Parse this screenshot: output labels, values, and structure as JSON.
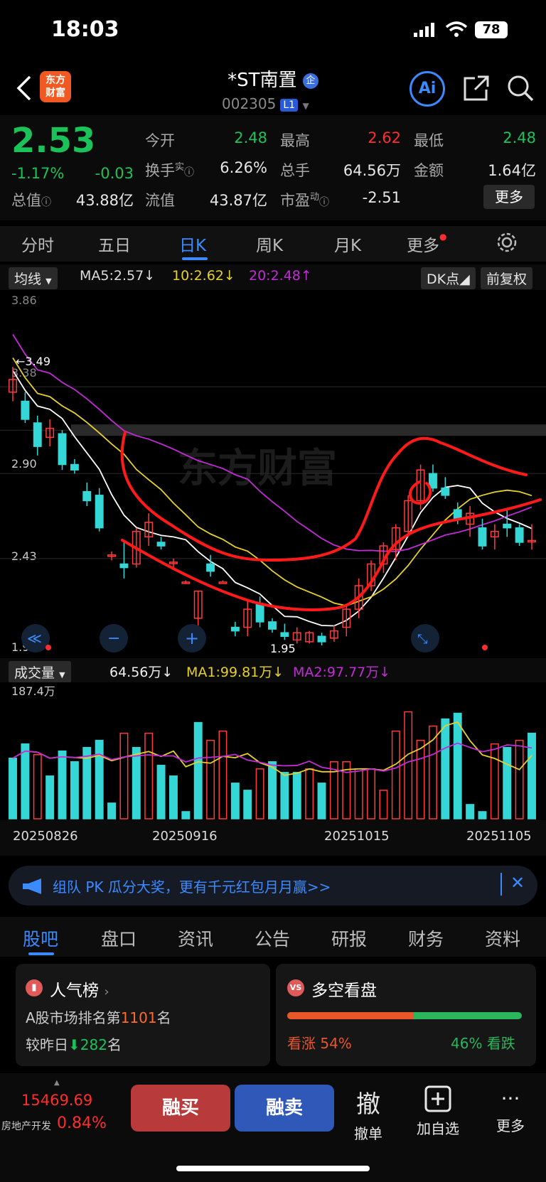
{
  "status": {
    "time": "18:03",
    "battery": "78"
  },
  "header": {
    "name": "*ST南置",
    "badge": "企",
    "code": "002305",
    "level": "L1",
    "logo_line1": "东方",
    "logo_line2": "财富"
  },
  "quote": {
    "price": "2.53",
    "change_pct": "-1.17%",
    "change": "-0.03",
    "open_label": "今开",
    "open": "2.48",
    "high_label": "最高",
    "high": "2.62",
    "low_label": "最低",
    "low": "2.48",
    "turnover_label": "换手",
    "turnover_sup": "实",
    "turnover": "6.26%",
    "volume_label": "总手",
    "volume": "64.56万",
    "amount_label": "金额",
    "amount": "1.64亿",
    "mktcap_label": "总值",
    "mktcap": "43.88亿",
    "float_label": "流值",
    "float": "43.87亿",
    "pe_label": "市盈",
    "pe_sup": "动",
    "pe": "-2.51",
    "more": "更多"
  },
  "tabs": [
    "分时",
    "五日",
    "日K",
    "周K",
    "月K",
    "更多"
  ],
  "ma": {
    "selector": "均线",
    "ma5": "MA5:2.57",
    "ma10": "10:2.62",
    "ma20": "20:2.48",
    "dk": "DK点",
    "adjust": "前复权"
  },
  "chart_axis": {
    "y_top": "3.86",
    "y_2": "3.38",
    "y_3": "2.90",
    "y_4": "2.43",
    "y_low": "1.95",
    "high_mark": "3.49",
    "low_mark": "1.95",
    "watermark": "东方财富"
  },
  "volume": {
    "selector": "成交量",
    "current": "64.56万",
    "ma1": "MA1:99.81万",
    "ma2": "MA2:97.77万",
    "y_max": "187.4万",
    "dates": [
      "20250826",
      "20250916",
      "20251015",
      "20251105"
    ]
  },
  "banner": {
    "text": "组队 PK 瓜分大奖，更有千元红包月月赢>>"
  },
  "bottom_tabs": [
    "股吧",
    "盘口",
    "资讯",
    "公告",
    "研报",
    "财务",
    "资料"
  ],
  "card1": {
    "title": "人气榜",
    "line1_prefix": "A股市场排名第",
    "rank": "1101",
    "line1_suffix": "名",
    "line2_prefix": "较昨日",
    "delta": "282",
    "line2_suffix": "名"
  },
  "card2": {
    "title": "多空看盘",
    "bull_label": "看涨",
    "bull_pct": "54%",
    "bear_pct": "46%",
    "bear_label": "看跌",
    "bull_value": 54
  },
  "footer": {
    "index": "15469.69",
    "sector": "房地产开发",
    "sector_pct": "0.84%",
    "buy": "融买",
    "sell": "融卖",
    "cancel": "撤单",
    "cancel_char": "撤",
    "watch": "加自选",
    "more": "更多"
  },
  "chart_data": {
    "type": "candlestick",
    "y_ticks": [
      3.86,
      3.38,
      2.9,
      2.43,
      1.95
    ],
    "ylim": [
      1.95,
      3.86
    ],
    "vol_ylim": [
      0,
      187.4
    ],
    "candles": [
      [
        3.35,
        3.49,
        3.3,
        3.42
      ],
      [
        3.3,
        3.35,
        3.18,
        3.2
      ],
      [
        3.18,
        3.22,
        3.0,
        3.05
      ],
      [
        3.1,
        3.2,
        3.05,
        3.15
      ],
      [
        3.12,
        3.14,
        2.92,
        2.95
      ],
      [
        2.95,
        2.98,
        2.9,
        2.92
      ],
      [
        2.8,
        2.85,
        2.72,
        2.75
      ],
      [
        2.78,
        2.82,
        2.58,
        2.6
      ],
      [
        2.45,
        2.47,
        2.42,
        2.45
      ],
      [
        2.4,
        2.52,
        2.32,
        2.38
      ],
      [
        2.4,
        2.6,
        2.38,
        2.58
      ],
      [
        2.55,
        2.68,
        2.5,
        2.63
      ],
      [
        2.52,
        2.55,
        2.48,
        2.5
      ],
      [
        2.41,
        2.43,
        2.38,
        2.41
      ],
      [
        2.3,
        2.31,
        2.29,
        2.3
      ],
      [
        2.1,
        2.25,
        2.05,
        2.25
      ],
      [
        2.4,
        2.45,
        2.33,
        2.36
      ],
      [
        2.3,
        2.31,
        2.3,
        2.3
      ],
      [
        2.05,
        2.08,
        2.0,
        2.03
      ],
      [
        2.05,
        2.2,
        2.0,
        2.15
      ],
      [
        2.18,
        2.22,
        2.05,
        2.08
      ],
      [
        2.08,
        2.1,
        2.02,
        2.04
      ],
      [
        2.02,
        2.07,
        1.98,
        2.0
      ],
      [
        1.98,
        2.05,
        1.96,
        2.02
      ],
      [
        1.97,
        2.03,
        1.96,
        2.02
      ],
      [
        2.0,
        2.02,
        1.95,
        1.97
      ],
      [
        1.99,
        2.06,
        1.97,
        2.03
      ],
      [
        2.05,
        2.18,
        2.0,
        2.15
      ],
      [
        2.15,
        2.32,
        2.1,
        2.28
      ],
      [
        2.28,
        2.42,
        2.25,
        2.4
      ],
      [
        2.4,
        2.52,
        2.35,
        2.5
      ],
      [
        2.48,
        2.62,
        2.42,
        2.6
      ],
      [
        2.58,
        2.78,
        2.55,
        2.75
      ],
      [
        2.75,
        2.95,
        2.7,
        2.92
      ],
      [
        2.9,
        2.95,
        2.8,
        2.82
      ],
      [
        2.82,
        2.88,
        2.76,
        2.78
      ],
      [
        2.7,
        2.74,
        2.62,
        2.65
      ],
      [
        2.62,
        2.72,
        2.55,
        2.68
      ],
      [
        2.6,
        2.65,
        2.48,
        2.5
      ],
      [
        2.55,
        2.62,
        2.48,
        2.58
      ],
      [
        2.62,
        2.7,
        2.55,
        2.6
      ],
      [
        2.6,
        2.62,
        2.5,
        2.52
      ],
      [
        2.53,
        2.62,
        2.48,
        2.53
      ]
    ],
    "volumes": [
      85,
      105,
      90,
      60,
      95,
      80,
      100,
      110,
      22,
      120,
      100,
      120,
      75,
      60,
      10,
      135,
      110,
      123,
      50,
      40,
      70,
      80,
      65,
      65,
      70,
      50,
      80,
      80,
      70,
      70,
      40,
      123,
      150,
      110,
      130,
      140,
      148,
      20,
      10,
      105,
      100,
      110,
      120
    ],
    "vol_up": [
      false,
      false,
      true,
      false,
      false,
      false,
      false,
      false,
      false,
      true,
      false,
      true,
      false,
      false,
      false,
      false,
      true,
      true,
      false,
      false,
      true,
      false,
      false,
      false,
      true,
      false,
      true,
      true,
      true,
      true,
      true,
      true,
      true,
      true,
      true,
      false,
      false,
      false,
      false,
      true,
      false,
      true,
      false
    ]
  }
}
